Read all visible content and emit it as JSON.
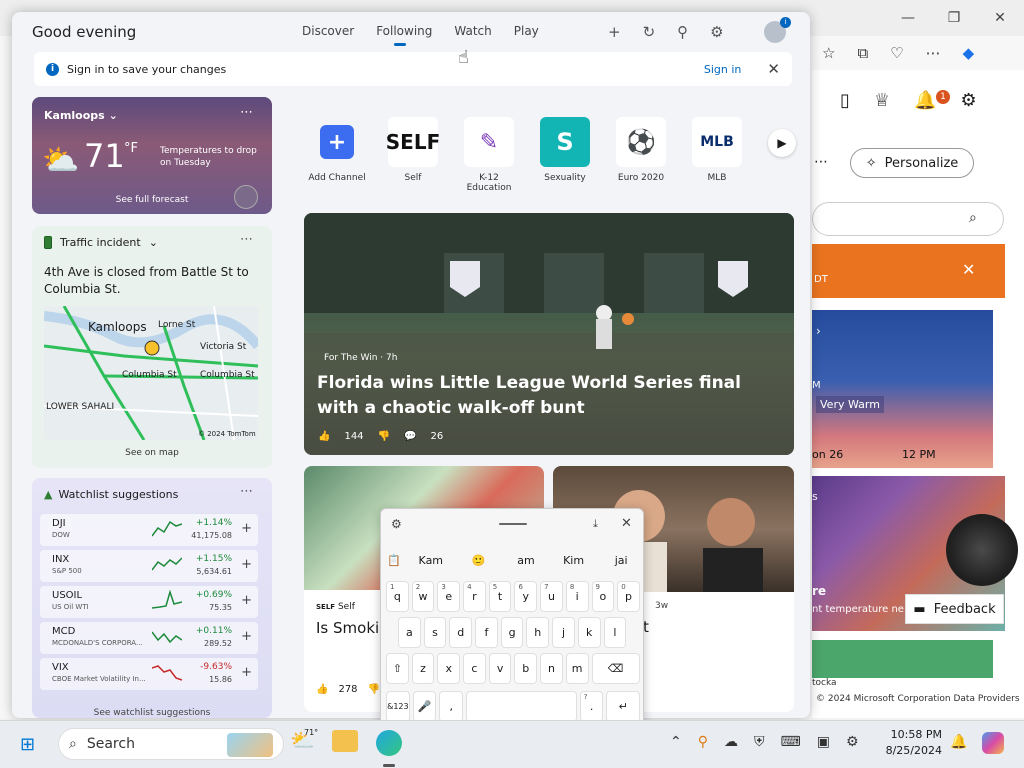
{
  "panel": {
    "greeting": "Good evening",
    "tabs": [
      {
        "label": "Discover"
      },
      {
        "label": "Following"
      },
      {
        "label": "Watch"
      },
      {
        "label": "Play"
      }
    ],
    "active_tab": "Following",
    "actions": {
      "add": "+",
      "refresh": "↻",
      "pin": "⚲",
      "settings": "⚙"
    },
    "profile_badge": "i"
  },
  "signin": {
    "message": "Sign in to save your changes",
    "link": "Sign in",
    "close": "✕"
  },
  "weather": {
    "city": "Kamloops",
    "temp": "71",
    "unit": "°F",
    "note": "Temperatures to drop on Tuesday",
    "forecast_link": "See full forecast"
  },
  "traffic": {
    "title": "Traffic incident",
    "description": "4th Ave is closed from Battle St to Columbia St.",
    "map_labels": [
      "Kamloops",
      "Lorne St",
      "Victoria St",
      "Columbia St",
      "Columbia St",
      "LOWER SAHALI",
      "© 2024 TomTom"
    ],
    "see_map": "See on map"
  },
  "watchlist": {
    "title": "Watchlist suggestions",
    "stocks": [
      {
        "symbol": "DJI",
        "name": "DOW",
        "change": "+1.14%",
        "price": "41,175.08",
        "up": true
      },
      {
        "symbol": "INX",
        "name": "S&P 500",
        "change": "+1.15%",
        "price": "5,634.61",
        "up": true
      },
      {
        "symbol": "USOIL",
        "name": "US Oil WTI",
        "change": "+0.69%",
        "price": "75.35",
        "up": true
      },
      {
        "symbol": "MCD",
        "name": "MCDONALD'S CORPORA...",
        "change": "+0.11%",
        "price": "289.52",
        "up": true
      },
      {
        "symbol": "VIX",
        "name": "CBOE Market Volatility In...",
        "change": "-9.63%",
        "price": "15.86",
        "up": false
      }
    ],
    "footer": "See watchlist suggestions"
  },
  "channels": [
    {
      "label": "Add Channel",
      "tile": "+",
      "color": "#3c6df0",
      "fg": "#ffffff"
    },
    {
      "label": "Self",
      "tile": "SELF",
      "color": "#ffffff",
      "fg": "#111111"
    },
    {
      "label": "K-12 Education",
      "tile": "✎",
      "color": "#ffffff",
      "fg": "#7a3ab8"
    },
    {
      "label": "Sexuality",
      "tile": "S",
      "color": "#13b4b4",
      "fg": "#ffffff"
    },
    {
      "label": "Euro 2020",
      "tile": "⚽",
      "color": "#ffffff",
      "fg": "#1f6a3a"
    },
    {
      "label": "MLB",
      "tile": "MLB",
      "color": "#ffffff",
      "fg": "#0a2d6e"
    }
  ],
  "main_article": {
    "source": "For The Win · 7h",
    "title": "Florida wins Little League World Series final with a chaotic walk-off bunt",
    "likes": "144",
    "comments": "26"
  },
  "sub_article_1": {
    "source": "Self",
    "title": "Is Smoki… Your Hea…",
    "likes": "278"
  },
  "sub_article_2": {
    "time": "3w",
    "title_fragment": "t"
  },
  "keyboard": {
    "suggestions": [
      "Kam",
      "🙂",
      "am",
      "Kim",
      "jai"
    ],
    "row1": [
      {
        "k": "q",
        "s": "1"
      },
      {
        "k": "w",
        "s": "2"
      },
      {
        "k": "e",
        "s": "3"
      },
      {
        "k": "r",
        "s": "4"
      },
      {
        "k": "t",
        "s": "5"
      },
      {
        "k": "y",
        "s": "6"
      },
      {
        "k": "u",
        "s": "7"
      },
      {
        "k": "i",
        "s": "8"
      },
      {
        "k": "o",
        "s": "9"
      },
      {
        "k": "p",
        "s": "0"
      }
    ],
    "row2": [
      "a",
      "s",
      "d",
      "f",
      "g",
      "h",
      "j",
      "k",
      "l"
    ],
    "row3": [
      "⇧",
      "z",
      "x",
      "c",
      "v",
      "b",
      "n",
      "m",
      "⌫"
    ],
    "row4": [
      {
        "k": "&123"
      },
      {
        "k": "🎤"
      },
      {
        "k": ","
      },
      {
        "k": " "
      },
      {
        "k": ".",
        "s": "?"
      },
      {
        "k": "↵"
      }
    ]
  },
  "background": {
    "personalize": "Personalize",
    "alert_text": "DT",
    "weather_label": "Very Warm",
    "weather_time": "12 PM",
    "weather_date": "on 26",
    "weather_m": "M",
    "map_text": "nt temperature ne",
    "map_sub": "re",
    "feedback": "Feedback",
    "footer": "© 2024 Microsoft Corporation  Data Providers",
    "map_label_side": "s",
    "footer_left": "tocka"
  },
  "taskbar": {
    "search": "Search",
    "weather_temp": "71°",
    "time": "10:58 PM",
    "date": "8/25/2024"
  }
}
